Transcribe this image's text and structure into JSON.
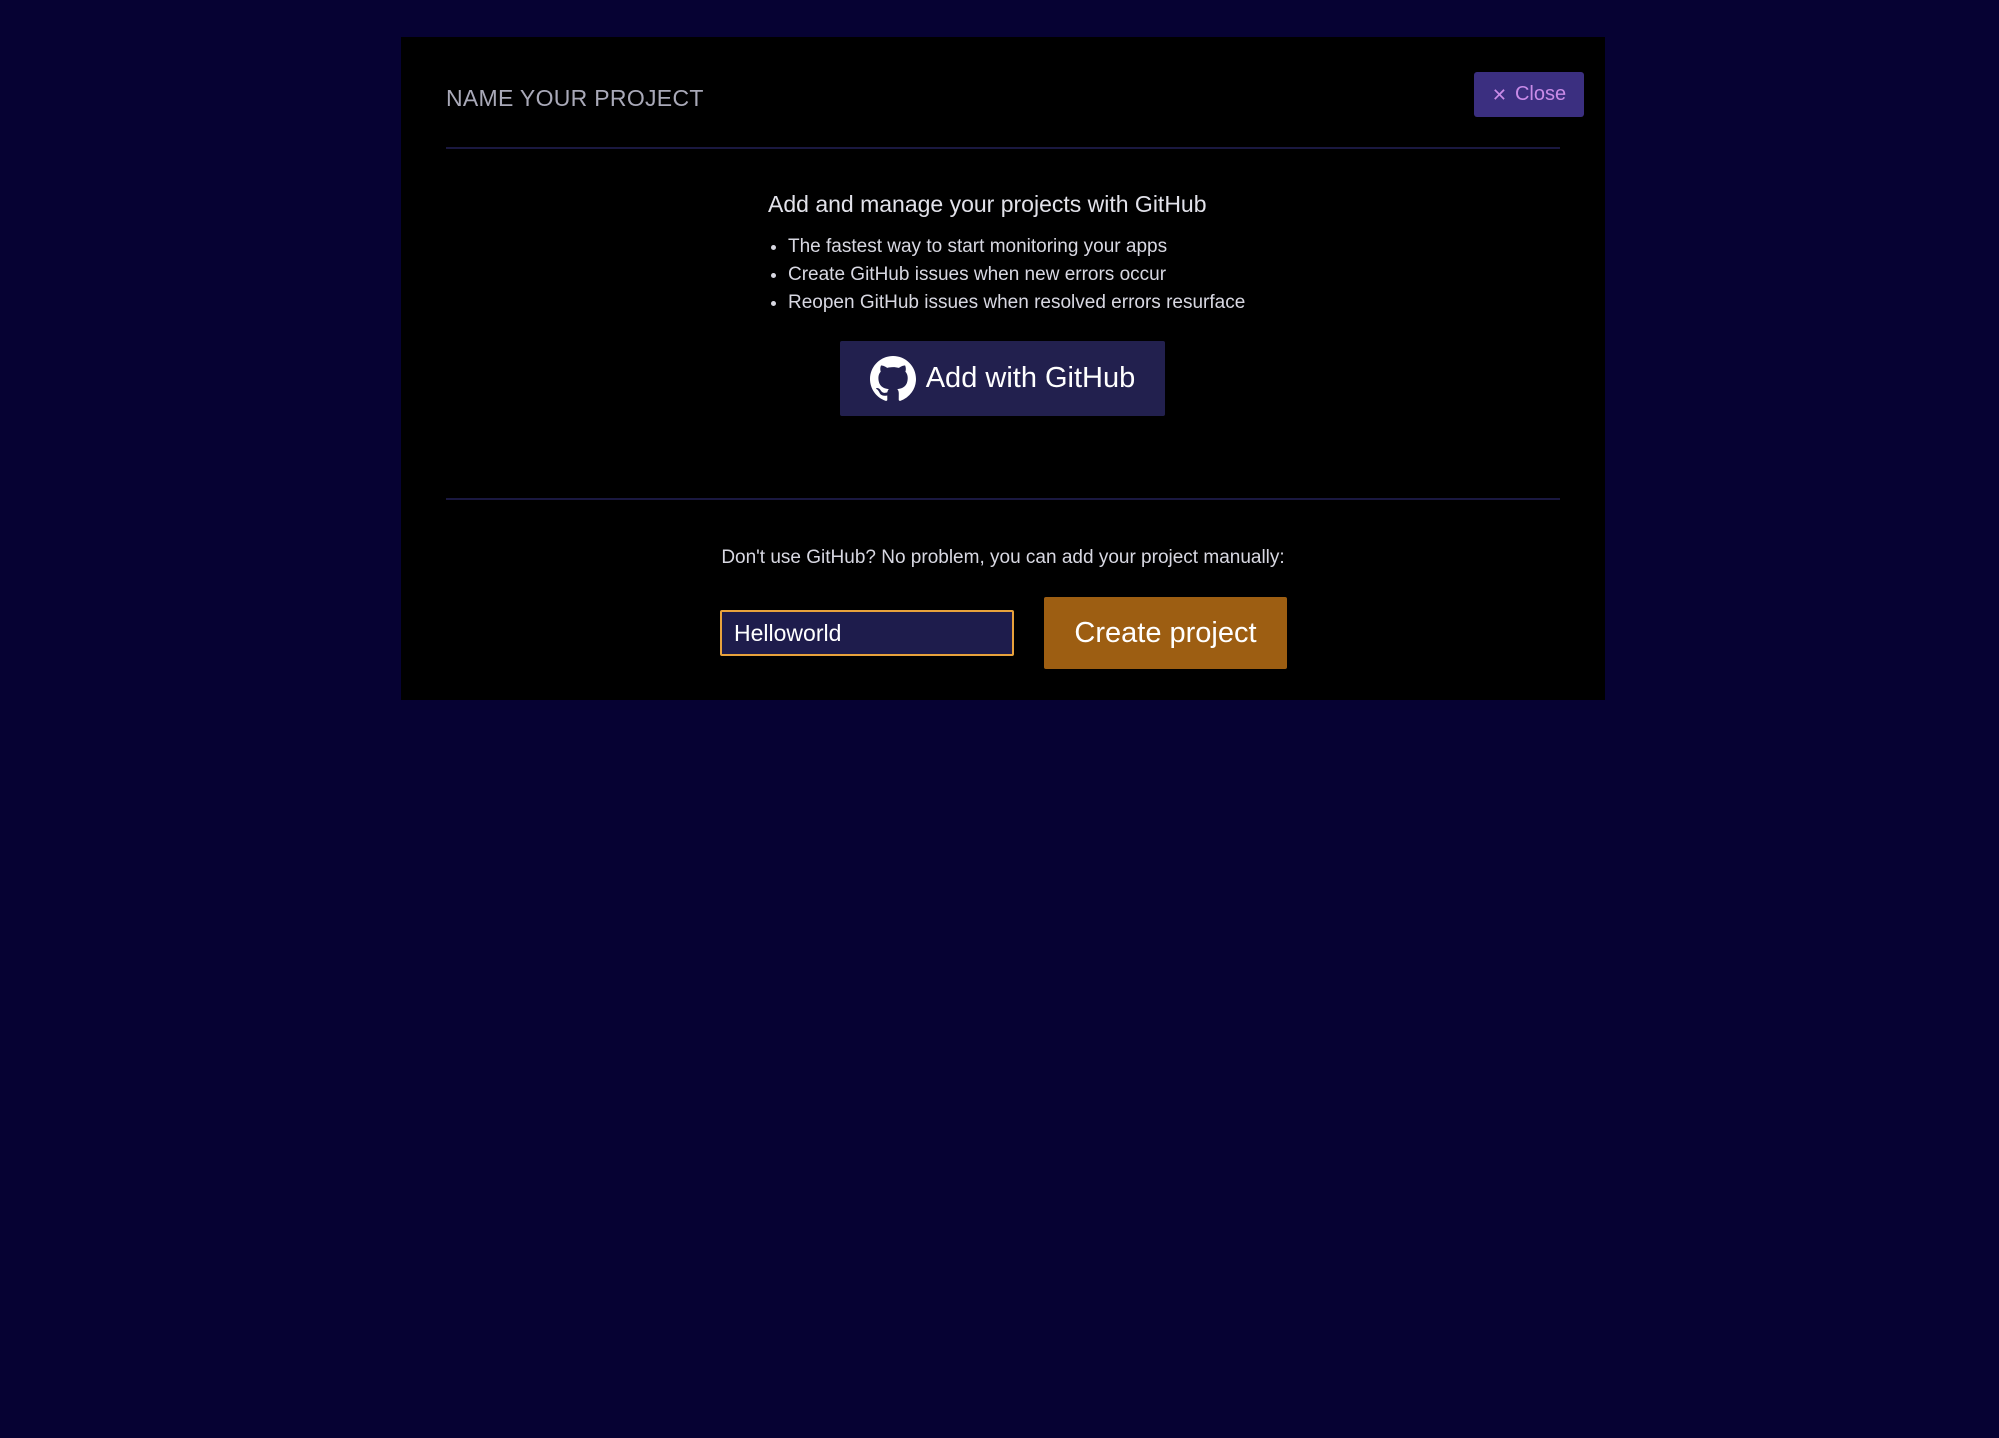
{
  "modal": {
    "title": "NAME YOUR PROJECT",
    "close_label": "Close",
    "close_icon": "close-icon"
  },
  "github": {
    "heading": "Add and manage your projects with GitHub",
    "features": [
      "The fastest way to start monitoring your apps",
      "Create GitHub issues when new errors occur",
      "Reopen GitHub issues when resolved errors resurface"
    ],
    "button_label": "Add with GitHub",
    "button_icon": "github-icon"
  },
  "manual": {
    "text": "Don't use GitHub? No problem, you can add your project manually:",
    "input_value": "Helloworld",
    "create_label": "Create project"
  },
  "colors": {
    "page_background": "#060233",
    "modal_background": "#000000",
    "close_button_background": "#3b2f80",
    "close_button_text": "#c98be8",
    "github_button_background": "#22204e",
    "input_background": "#1e1c4c",
    "input_border": "#e8a23c",
    "create_button_background": "#9d5e12"
  }
}
